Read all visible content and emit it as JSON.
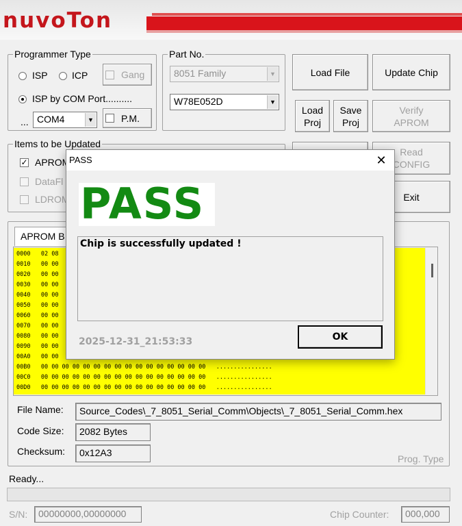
{
  "brand": {
    "logo_text": "nuvoTon",
    "accent": "#d9141b"
  },
  "programmer_type": {
    "title": "Programmer Type",
    "isp": "ISP",
    "icp": "ICP",
    "gang": "Gang",
    "isp_by_com": "ISP by COM Port..........",
    "com_prefix": "...",
    "com_port": "COM4",
    "pm": "P.M."
  },
  "part_no": {
    "title": "Part No.",
    "family": "8051 Family",
    "part": "W78E052D"
  },
  "buttons": {
    "load_file": "Load File",
    "update_chip": "Update Chip",
    "load_proj_1": "Load",
    "load_proj_2": "Proj",
    "save_proj_1": "Save",
    "save_proj_2": "Proj",
    "verify_1": "Verify",
    "verify_2": "APROM",
    "read_1": "Read",
    "read_2": "CONFIG",
    "exit": "Exit"
  },
  "items": {
    "title": "Items to be Updated",
    "aprom": "APROM",
    "dataflash": "DataFl",
    "ldrom": "LDROM"
  },
  "tab": {
    "label": "APROM B"
  },
  "hex_rows": [
    {
      "addr": "0000",
      "data": "02 08"
    },
    {
      "addr": "0010",
      "data": "00 00"
    },
    {
      "addr": "0020",
      "data": "00 00"
    },
    {
      "addr": "0030",
      "data": "00 00"
    },
    {
      "addr": "0040",
      "data": "00 00"
    },
    {
      "addr": "0050",
      "data": "00 00"
    },
    {
      "addr": "0060",
      "data": "00 00"
    },
    {
      "addr": "0070",
      "data": "00 00"
    },
    {
      "addr": "0080",
      "data": "00 00"
    },
    {
      "addr": "0090",
      "data": "00 00"
    },
    {
      "addr": "00A0",
      "data": "00 00"
    },
    {
      "addr": "00B0",
      "data": "00 00 00 00 00 00 00 00 00 00 00 00 00 00 00 00   ................"
    },
    {
      "addr": "00C0",
      "data": "00 00 00 00 00 00 00 00 00 00 00 00 00 00 00 00   ................"
    },
    {
      "addr": "00D0",
      "data": "00 00 00 00 00 00 00 00 00 00 00 00 00 00 00 00   ................"
    }
  ],
  "file_info": {
    "file_name_label": "File Name:",
    "file_name": "Source_Codes\\_7_8051_Serial_Comm\\Objects\\_7_8051_Serial_Comm.hex",
    "code_size_label": "Code Size:",
    "code_size": "2082 Bytes",
    "checksum_label": "Checksum:",
    "checksum": "0x12A3",
    "prog_type": "Prog. Type"
  },
  "status": {
    "text": "Ready...",
    "sn_label": "S/N:",
    "sn": "00000000,00000000",
    "chip_counter_label": "Chip Counter:",
    "chip_counter": "000,000"
  },
  "dialog": {
    "title": "PASS",
    "close": "✕",
    "pass_text": "PASS",
    "pass_color": "#138a13",
    "message": "Chip is successfully updated !",
    "timestamp": "2025-12-31_21:53:33",
    "ok": "OK"
  }
}
